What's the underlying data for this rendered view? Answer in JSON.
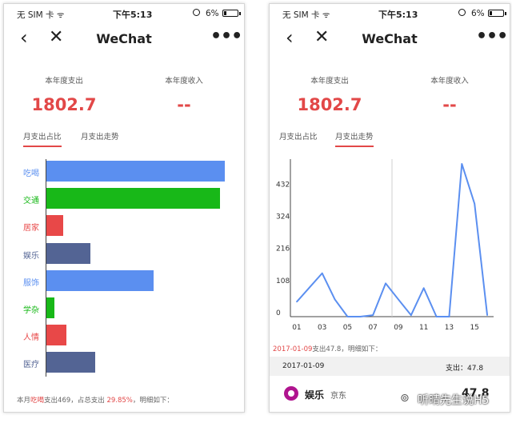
{
  "screens": [
    {
      "status_bar": {
        "carrier": "无 SIM 卡 ᯤ",
        "time": "下午5:13",
        "battery": "6%"
      },
      "nav": {
        "back": "‹",
        "close": "✕",
        "title": "WeChat",
        "more": "•••"
      },
      "summary": {
        "expense_label": "本年度支出",
        "expense_value": "1802.7",
        "income_label": "本年度收入",
        "income_value": "--"
      },
      "tabs": [
        {
          "label": "月支出占比",
          "active": true
        },
        {
          "label": "月支出走势",
          "active": false
        }
      ],
      "footer": {
        "prefix": "本月",
        "category": "吃喝",
        "mid": "支出469，占总支出 ",
        "percent": "29.85%",
        "suffix": "，明细如下："
      }
    },
    {
      "status_bar": {
        "carrier": "无 SIM 卡 ᯤ",
        "time": "下午5:13",
        "battery": "6%"
      },
      "nav": {
        "back": "‹",
        "close": "✕",
        "title": "WeChat",
        "more": "•••"
      },
      "summary": {
        "expense_label": "本年度支出",
        "expense_value": "1802.7",
        "income_label": "本年度收入",
        "income_value": "--"
      },
      "tabs": [
        {
          "label": "月支出占比",
          "active": false
        },
        {
          "label": "月支出走势",
          "active": true
        }
      ],
      "detail": {
        "date_red": "2017-01-09",
        "date_rest": "支出47.8，明细如下：",
        "row_date": "2017-01-09",
        "row_amount": "支出：47.8"
      },
      "transaction": {
        "category": "娱乐",
        "merchant": "京东",
        "amount": "47.8"
      }
    }
  ],
  "chart_data": [
    {
      "type": "bar",
      "orientation": "horizontal",
      "categories": [
        "吃喝",
        "交通",
        "居家",
        "娱乐",
        "服饰",
        "学杂",
        "人情",
        "医疗"
      ],
      "values": [
        469,
        457,
        44,
        116,
        283,
        20,
        52,
        128
      ],
      "colors": [
        "#5b8ff0",
        "#18b818",
        "#e84848",
        "#536494",
        "#5b8ff0",
        "#18b818",
        "#e84848",
        "#536494"
      ],
      "xlim": [
        0,
        480
      ]
    },
    {
      "type": "line",
      "x": [
        0.5,
        1.5,
        2.5,
        3.5,
        4.5,
        5.5,
        6.5,
        7.5,
        8.5,
        9.5,
        10.5,
        11.5,
        12.5,
        13.5,
        14.5,
        15.5
      ],
      "values": [
        50,
        98,
        146,
        58,
        0,
        0,
        5,
        112,
        58,
        5,
        96,
        0,
        0,
        514,
        380,
        5
      ],
      "x_tick_labels": [
        "01",
        "03",
        "05",
        "07",
        "09",
        "11",
        "13",
        "15"
      ],
      "y_ticks": [
        0,
        108,
        216,
        324,
        432
      ],
      "ylim": [
        0,
        530
      ],
      "xlim": [
        0,
        16
      ],
      "color": "#5b8ff0",
      "grid": false
    }
  ],
  "watermark": {
    "icon": "wechat-icon",
    "text": "听晴先生说H5"
  }
}
